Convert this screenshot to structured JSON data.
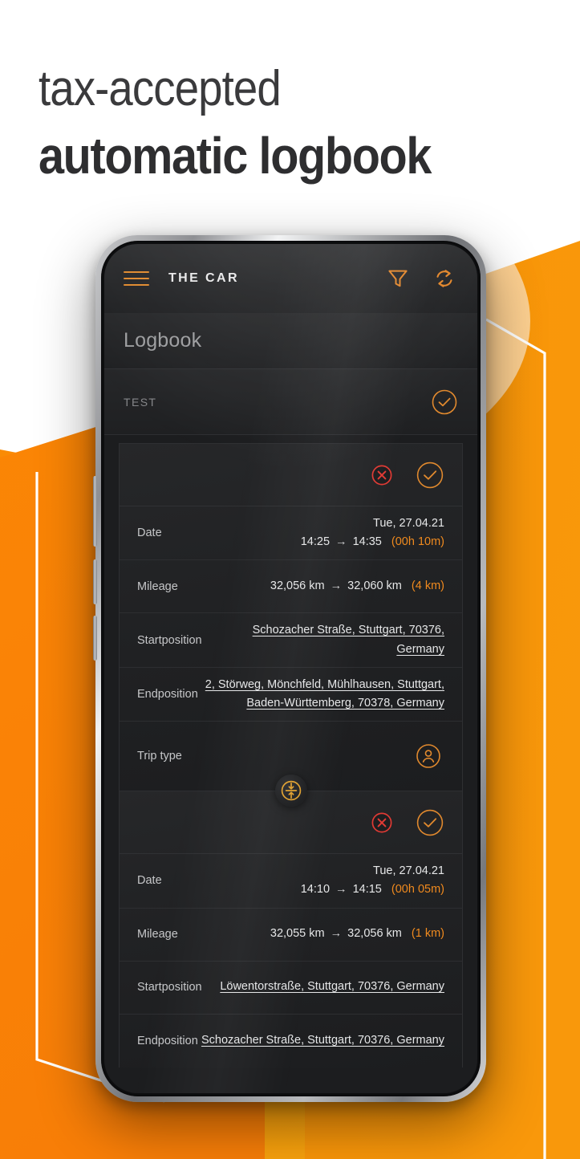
{
  "promo": {
    "headline_line1": "tax-accepted",
    "headline_line2": "automatic logbook"
  },
  "colors": {
    "orange_left": "#F97F06",
    "orange_right": "#F99609",
    "accent": "#F08A1E",
    "danger": "#E03A34",
    "screen_bg": "#1C1D1F",
    "page_bg": "#FFFFFF"
  },
  "app": {
    "appbar": {
      "menu_icon": "hamburger-menu-icon",
      "title": "THE CAR",
      "filter_icon": "filter-funnel-icon",
      "refresh_icon": "refresh-sync-icon"
    },
    "subbar": {
      "title": "Logbook"
    },
    "group": {
      "label": "TEST",
      "confirm_icon": "check-circle-icon"
    },
    "labels": {
      "date": "Date",
      "mileage": "Mileage",
      "startposition": "Startposition",
      "endposition": "Endposition",
      "trip_type": "Trip type"
    },
    "icons": {
      "reject": "x-circle-icon",
      "accept": "check-circle-icon",
      "trip_type_private": "person-circle-icon",
      "merge": "merge-trips-icon"
    },
    "trips": [
      {
        "date_day": "Tue, 27.04.21",
        "time_from": "14:25",
        "time_arrow": "→",
        "time_to": "14:35",
        "duration": "(00h 10m)",
        "mileage_from": "32,056 km",
        "mileage_arrow": "→",
        "mileage_to": "32,060 km",
        "distance": "(4 km)",
        "startposition": "Schozacher Straße, Stuttgart, 70376, Germany",
        "endposition_line1": "2, Störweg, Mönchfeld, Mühlhausen, Stuttgart,",
        "endposition_line2": "Baden-Württemberg, 70378, Germany",
        "trip_type_label": "Trip type"
      },
      {
        "date_day": "Tue, 27.04.21",
        "time_from": "14:10",
        "time_arrow": "→",
        "time_to": "14:15",
        "duration": "(00h 05m)",
        "mileage_from": "32,055 km",
        "mileage_arrow": "→",
        "mileage_to": "32,056 km",
        "distance": "(1 km)",
        "startposition": "Löwentorstraße, Stuttgart, 70376, Germany",
        "endposition_line1": "Schozacher Straße, Stuttgart, 70376, Germany"
      }
    ]
  }
}
